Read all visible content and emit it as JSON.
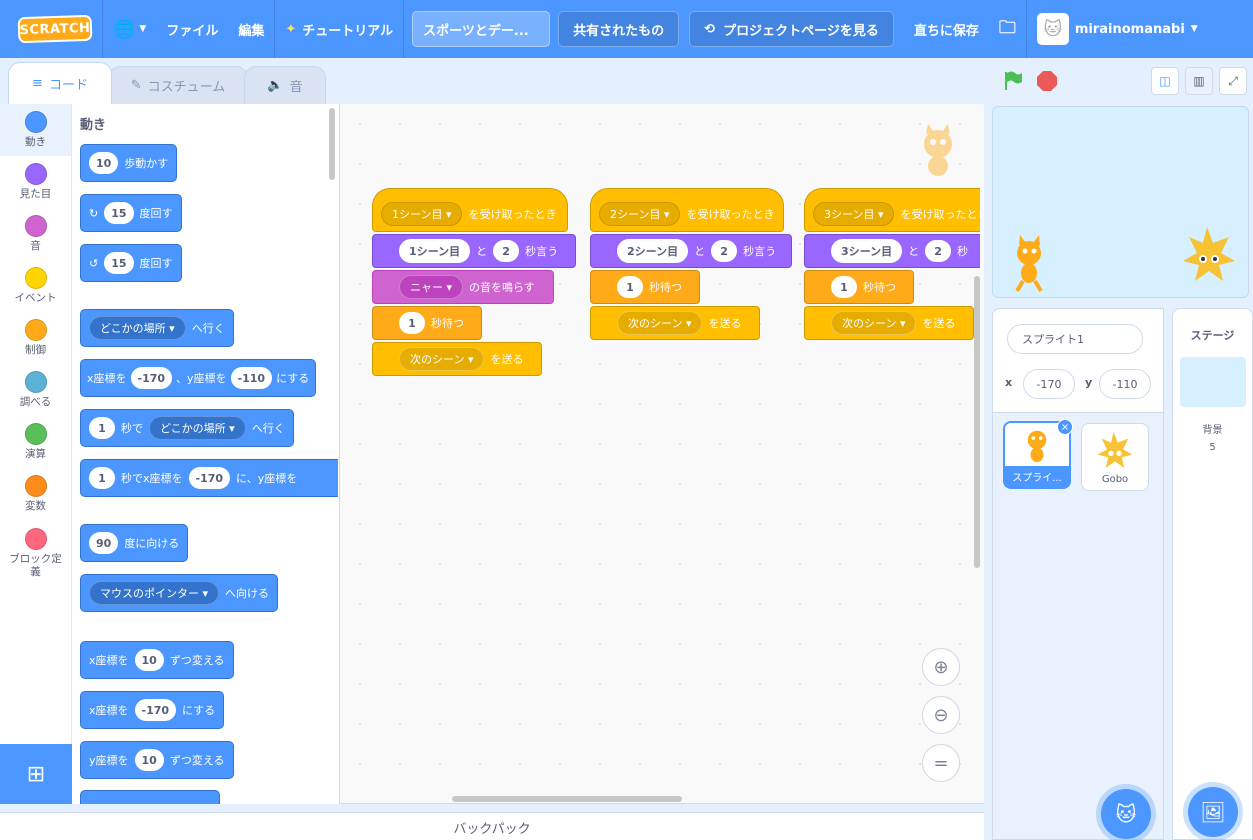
{
  "menubar": {
    "logo": "SCRATCH",
    "file": "ファイル",
    "edit": "編集",
    "tutorial": "チュートリアル",
    "project_title": "スポーツとデー...",
    "share": "共有されたもの",
    "see_project_page": "プロジェクトページを見る",
    "save_now": "直ちに保存",
    "username": "mirainomanabi"
  },
  "tabs": {
    "code": "コード",
    "costumes": "コスチューム",
    "sounds": "音"
  },
  "categories": [
    {
      "label": "動き",
      "color": "#4c97ff"
    },
    {
      "label": "見た目",
      "color": "#9966ff"
    },
    {
      "label": "音",
      "color": "#cf63cf"
    },
    {
      "label": "イベント",
      "color": "#ffd500"
    },
    {
      "label": "制御",
      "color": "#ffab19"
    },
    {
      "label": "調べる",
      "color": "#5cb1d6"
    },
    {
      "label": "演算",
      "color": "#59c059"
    },
    {
      "label": "変数",
      "color": "#ff8c1a"
    },
    {
      "label": "ブロック定\n義",
      "color": "#ff6680"
    }
  ],
  "palette": {
    "heading": "動き",
    "move_steps": {
      "n": "10",
      "t": "歩動かす"
    },
    "turn_right": {
      "n": "15",
      "t": "度回す"
    },
    "turn_left": {
      "n": "15",
      "t": "度回す"
    },
    "goto": {
      "dd": "どこかの場所 ▾",
      "t": "へ行く"
    },
    "goto_xy": {
      "a": "x座標を",
      "x": "-170",
      "b": "、y座標を",
      "y": "-110",
      "c": "にする"
    },
    "glide": {
      "n": "1",
      "a": "秒で",
      "dd": "どこかの場所 ▾",
      "t": "へ行く"
    },
    "glide_xy": {
      "n": "1",
      "a": "秒でx座標を",
      "x": "-170",
      "b": "に、y座標を"
    },
    "point_dir": {
      "n": "90",
      "t": "度に向ける"
    },
    "point_towards": {
      "dd": "マウスのポインター ▾",
      "t": "へ向ける"
    },
    "change_x": {
      "a": "x座標を",
      "n": "10",
      "t": "ずつ変える"
    },
    "set_x": {
      "a": "x座標を",
      "n": "-170",
      "t": "にする"
    },
    "change_y": {
      "a": "y座標を",
      "n": "10",
      "t": "ずつ変える"
    }
  },
  "scripts": [
    {
      "hat": {
        "dd": "1シーン目 ▾",
        "t": "を受け取ったとき"
      },
      "say": {
        "msg": "1シーン目",
        "a": "と",
        "n": "2",
        "t": "秒言う"
      },
      "sound": {
        "dd": "ニャー ▾",
        "t": "の音を鳴らす"
      },
      "wait": {
        "n": "1",
        "t": "秒待つ"
      },
      "broadcast": {
        "dd": "次のシーン ▾",
        "t": "を送る"
      }
    },
    {
      "hat": {
        "dd": "2シーン目 ▾",
        "t": "を受け取ったとき"
      },
      "say": {
        "msg": "2シーン目",
        "a": "と",
        "n": "2",
        "t": "秒言う"
      },
      "wait": {
        "n": "1",
        "t": "秒待つ"
      },
      "broadcast": {
        "dd": "次のシーン ▾",
        "t": "を送る"
      }
    },
    {
      "hat": {
        "dd": "3シーン目 ▾",
        "t": "を受け取ったとき"
      },
      "say": {
        "msg": "3シーン目",
        "a": "と",
        "n": "2",
        "t": "秒"
      },
      "wait": {
        "n": "1",
        "t": "秒待つ"
      },
      "broadcast": {
        "dd": "次のシーン ▾",
        "t": "を送る"
      }
    }
  ],
  "backpack": "バックパック",
  "sprite_info": {
    "name": "スプライト1",
    "x_label": "x",
    "x": "-170",
    "y_label": "y",
    "y": "-110"
  },
  "sprites": [
    {
      "name": "スプライ..."
    },
    {
      "name": "Gobo"
    }
  ],
  "stage_pane": {
    "title": "ステージ",
    "backdrop_label": "背景",
    "backdrop_count": "5"
  },
  "colors": {
    "motion": "#4c97ff",
    "looks": "#9966ff",
    "sound": "#cf63cf",
    "events": "#ffbf00",
    "control": "#ffab19"
  }
}
